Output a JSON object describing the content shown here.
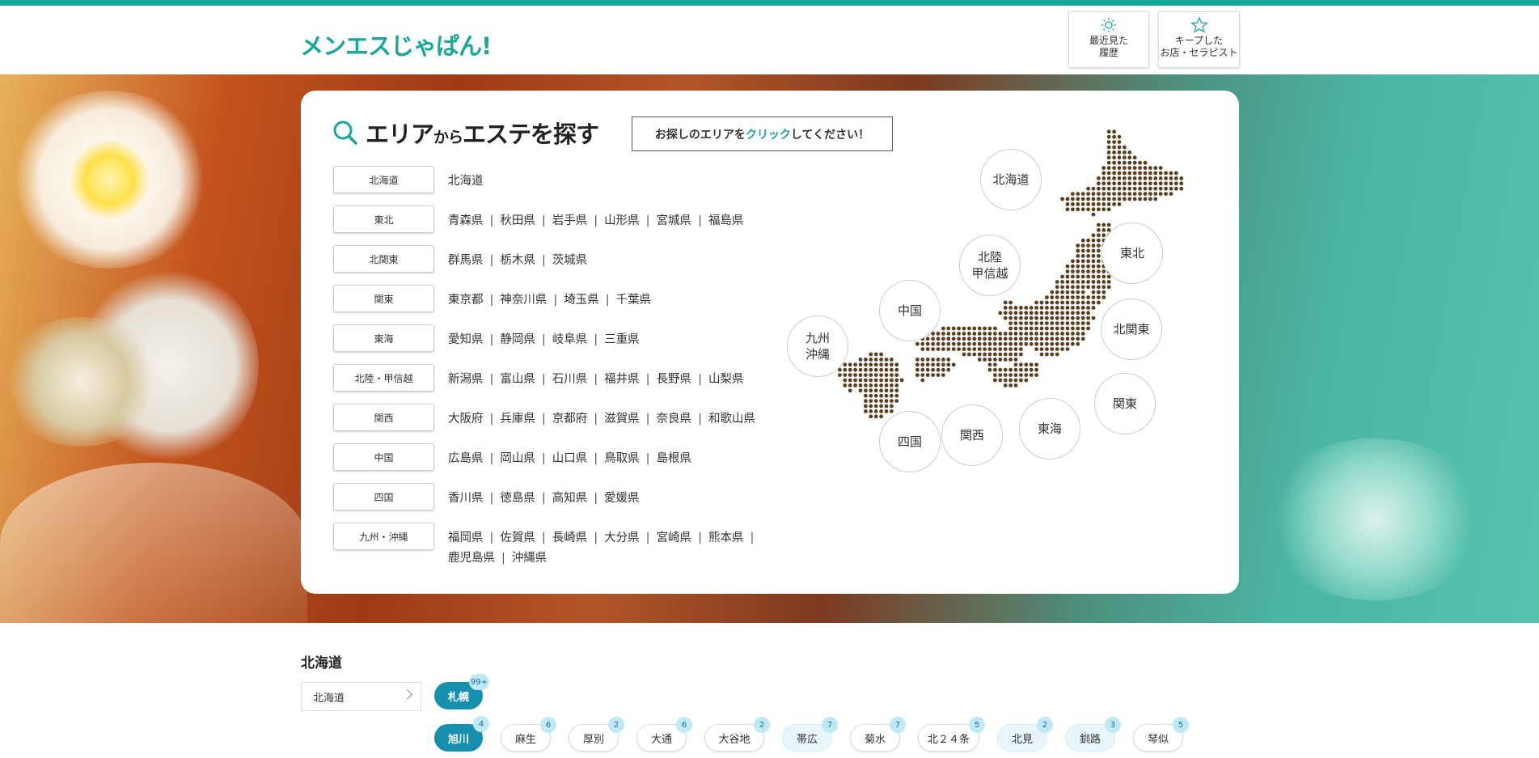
{
  "header": {
    "logo": "メンエスじゃぱん!",
    "history_label_1": "最近見た",
    "history_label_2": "履歴",
    "keep_label_1": "キープした",
    "keep_label_2": "お店・セラピスト"
  },
  "search": {
    "title_a": "エリア",
    "title_b": "から",
    "title_c": "エステを探す",
    "hint_a": "お探しのエリアを",
    "hint_b": "クリック",
    "hint_c": "してください！"
  },
  "regions": [
    {
      "name": "北海道",
      "prefs": [
        "北海道"
      ]
    },
    {
      "name": "東北",
      "prefs": [
        "青森県",
        "秋田県",
        "岩手県",
        "山形県",
        "宮城県",
        "福島県"
      ]
    },
    {
      "name": "北関東",
      "prefs": [
        "群馬県",
        "栃木県",
        "茨城県"
      ]
    },
    {
      "name": "関東",
      "prefs": [
        "東京都",
        "神奈川県",
        "埼玉県",
        "千葉県"
      ]
    },
    {
      "name": "東海",
      "prefs": [
        "愛知県",
        "静岡県",
        "岐阜県",
        "三重県"
      ]
    },
    {
      "name": "北陸・甲信越",
      "prefs": [
        "新潟県",
        "富山県",
        "石川県",
        "福井県",
        "長野県",
        "山梨県"
      ]
    },
    {
      "name": "関西",
      "prefs": [
        "大阪府",
        "兵庫県",
        "京都府",
        "滋賀県",
        "奈良県",
        "和歌山県"
      ]
    },
    {
      "name": "中国",
      "prefs": [
        "広島県",
        "岡山県",
        "山口県",
        "鳥取県",
        "島根県"
      ]
    },
    {
      "name": "四国",
      "prefs": [
        "香川県",
        "徳島県",
        "高知県",
        "愛媛県"
      ]
    },
    {
      "name": "九州・沖縄",
      "prefs": [
        "福岡県",
        "佐賀県",
        "長崎県",
        "大分県",
        "宮崎県",
        "熊本県",
        "鹿児島県",
        "沖縄県"
      ]
    }
  ],
  "map_labels": {
    "hokkaido": "北海道",
    "tohoku": "東北",
    "hokuriku_1": "北陸",
    "hokuriku_2": "甲信越",
    "kitakanto": "北関東",
    "chugoku": "中国",
    "kyushu_1": "九州",
    "kyushu_2": "沖縄",
    "kanto": "関東",
    "tokai": "東海",
    "kansai": "関西",
    "shikoku": "四国"
  },
  "area_section": {
    "title": "北海道",
    "select_value": "北海道",
    "primary_chip": {
      "label": "札幌",
      "count": "99+"
    },
    "chips": [
      {
        "label": "旭川",
        "count": "4",
        "state": "on"
      },
      {
        "label": "麻生",
        "count": "6",
        "state": "off"
      },
      {
        "label": "厚別",
        "count": "2",
        "state": "off"
      },
      {
        "label": "大通",
        "count": "6",
        "state": "off"
      },
      {
        "label": "大谷地",
        "count": "2",
        "state": "off"
      },
      {
        "label": "帯広",
        "count": "7",
        "state": "light"
      },
      {
        "label": "菊水",
        "count": "7",
        "state": "off"
      },
      {
        "label": "北２４条",
        "count": "5",
        "state": "off"
      },
      {
        "label": "北見",
        "count": "2",
        "state": "light"
      },
      {
        "label": "釧路",
        "count": "3",
        "state": "light"
      },
      {
        "label": "琴似",
        "count": "5",
        "state": "off"
      }
    ]
  },
  "colors": {
    "accent": "#17a79a",
    "chip_active": "#1790b0",
    "map_dot": "#5a3f1e"
  }
}
